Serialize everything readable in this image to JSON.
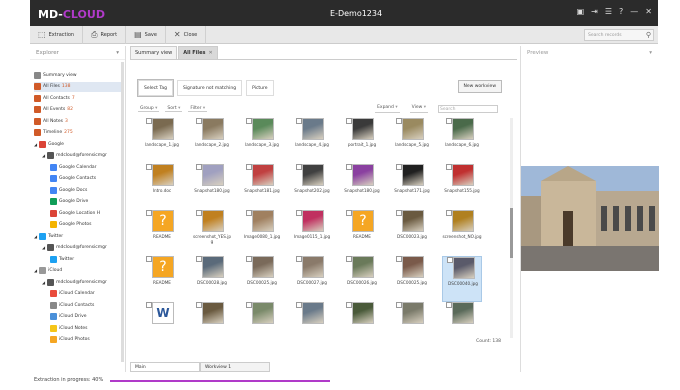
{
  "app": {
    "brand_main": "MD-",
    "brand_accent": "CLOUD",
    "case_name": "E-Demo1234",
    "accent_color": "#b03ac9"
  },
  "title_icons": [
    "screen-icon",
    "exit-icon",
    "settings-icon",
    "help-icon",
    "minimize-icon",
    "close-icon"
  ],
  "toolbar": {
    "buttons": [
      {
        "name": "extraction-button",
        "icon": "extraction-icon",
        "label": "Extraction"
      },
      {
        "name": "report-button",
        "icon": "printer-icon",
        "label": "Report"
      },
      {
        "name": "save-button",
        "icon": "save-icon",
        "label": "Save"
      },
      {
        "name": "close-case-button",
        "icon": "close-x-icon",
        "label": "Close"
      }
    ],
    "search_placeholder": "Search records"
  },
  "explorer": {
    "title": "Explorer",
    "items": [
      {
        "label": "Summary view",
        "count": "",
        "indent": 0,
        "color": "#888"
      },
      {
        "label": "All Files",
        "count": "138",
        "indent": 0,
        "color": "#d05a28",
        "selected": true
      },
      {
        "label": "All Contacts",
        "count": "7",
        "indent": 0,
        "color": "#d05a28"
      },
      {
        "label": "All Events",
        "count": "82",
        "indent": 0,
        "color": "#d05a28"
      },
      {
        "label": "All Notes",
        "count": "3",
        "indent": 0,
        "color": "#d05a28"
      },
      {
        "label": "Timeline",
        "count": "275",
        "indent": 0,
        "color": "#d05a28"
      },
      {
        "label": "Google",
        "count": "",
        "indent": 0,
        "color": "#db4437"
      },
      {
        "label": "mdcloud@forensicmgr",
        "count": "",
        "indent": 1,
        "color": "#555"
      },
      {
        "label": "Google Calendar",
        "count": "",
        "indent": 2,
        "color": "#4285f4"
      },
      {
        "label": "Google Contacts",
        "count": "",
        "indent": 2,
        "color": "#4285f4"
      },
      {
        "label": "Google Docs",
        "count": "",
        "indent": 2,
        "color": "#4285f4"
      },
      {
        "label": "Google Drive",
        "count": "",
        "indent": 2,
        "color": "#0f9d58"
      },
      {
        "label": "Google Location H",
        "count": "",
        "indent": 2,
        "color": "#db4437"
      },
      {
        "label": "Google Photos",
        "count": "",
        "indent": 2,
        "color": "#f4b400"
      },
      {
        "label": "Twitter",
        "count": "",
        "indent": 0,
        "color": "#1da1f2"
      },
      {
        "label": "mdcloud@forensicmgr",
        "count": "",
        "indent": 1,
        "color": "#555"
      },
      {
        "label": "Twitter",
        "count": "",
        "indent": 2,
        "color": "#1da1f2"
      },
      {
        "label": "iCloud",
        "count": "",
        "indent": 0,
        "color": "#999"
      },
      {
        "label": "mdcloud@forensicmgr",
        "count": "",
        "indent": 1,
        "color": "#555"
      },
      {
        "label": "iCloud Calendar",
        "count": "",
        "indent": 2,
        "color": "#e94b3c"
      },
      {
        "label": "iCloud Contacts",
        "count": "",
        "indent": 2,
        "color": "#888"
      },
      {
        "label": "iCloud Drive",
        "count": "",
        "indent": 2,
        "color": "#4a90d9"
      },
      {
        "label": "iCloud Notes",
        "count": "",
        "indent": 2,
        "color": "#f5c518"
      },
      {
        "label": "iCloud Photos",
        "count": "",
        "indent": 2,
        "color": "#f5a623"
      }
    ]
  },
  "tabs": [
    {
      "label": "Summary view",
      "active": false,
      "closable": false
    },
    {
      "label": "All Files",
      "active": true,
      "closable": true
    }
  ],
  "filters": {
    "buttons": [
      "Select Tag",
      "Signature not matching",
      "Picture"
    ],
    "new_workview": "New workview"
  },
  "controls": {
    "group": "Group",
    "sort": "Sort",
    "filter": "Filter",
    "expand": "Expand",
    "view": "View",
    "search": "Search"
  },
  "files": [
    {
      "label": "landscape_1.jpg",
      "kind": "photo",
      "color": "#7a6a50"
    },
    {
      "label": "landscape_2.jpg",
      "kind": "photo",
      "color": "#8a7a60"
    },
    {
      "label": "landscape_3.jpg",
      "kind": "photo",
      "color": "#5a8a5a"
    },
    {
      "label": "landscape_4.jpg",
      "kind": "photo",
      "color": "#6a7a8a"
    },
    {
      "label": "portrait_1.jpg",
      "kind": "photo",
      "color": "#3a3a3a"
    },
    {
      "label": "landscape_5.jpg",
      "kind": "photo",
      "color": "#9a8a60"
    },
    {
      "label": "landscape_6.jpg",
      "kind": "photo",
      "color": "#4a6a4a"
    },
    {
      "label": "Intro.doc",
      "kind": "photo",
      "color": "#c08020"
    },
    {
      "label": "Snapshot180.jpg",
      "kind": "photo",
      "color": "#a0a0c0"
    },
    {
      "label": "Snapshot181.jpg",
      "kind": "photo",
      "color": "#c04040"
    },
    {
      "label": "Snapshot202.jpg",
      "kind": "photo",
      "color": "#404040"
    },
    {
      "label": "Snapshot180.jpg",
      "kind": "photo",
      "color": "#8a40a0"
    },
    {
      "label": "Snapshot171.jpg",
      "kind": "photo",
      "color": "#202020"
    },
    {
      "label": "Snapshot155.jpg",
      "kind": "photo",
      "color": "#c03030"
    },
    {
      "label": "README",
      "kind": "unknown",
      "color": "#f5a623"
    },
    {
      "label": "screenshot_YES.jpg",
      "kind": "photo",
      "color": "#c08020"
    },
    {
      "label": "Image0080_1.jpg",
      "kind": "photo",
      "color": "#a08060"
    },
    {
      "label": "Image0115_1.jpg",
      "kind": "photo",
      "color": "#c03060"
    },
    {
      "label": "README",
      "kind": "unknown",
      "color": "#f5a623"
    },
    {
      "label": "DSC00023.jpg",
      "kind": "photo",
      "color": "#6a5a40"
    },
    {
      "label": "screenshot_NO.jpg",
      "kind": "photo",
      "color": "#b08020"
    },
    {
      "label": "README",
      "kind": "unknown",
      "color": "#f5a623"
    },
    {
      "label": "DSC00028.jpg",
      "kind": "photo",
      "color": "#5a6a7a"
    },
    {
      "label": "DSC00025.jpg",
      "kind": "photo",
      "color": "#7a6a5a"
    },
    {
      "label": "DSC00027.jpg",
      "kind": "photo",
      "color": "#8a7a6a"
    },
    {
      "label": "DSC00026.jpg",
      "kind": "photo",
      "color": "#6a7a5a"
    },
    {
      "label": "DSC00025.jpg",
      "kind": "photo",
      "color": "#7a5a4a"
    },
    {
      "label": "DSC00040.jpg",
      "kind": "photo",
      "color": "#5a5a6a",
      "selected": true
    },
    {
      "label": "",
      "kind": "word",
      "color": "#2b579a"
    },
    {
      "label": "",
      "kind": "photo",
      "color": "#6a5a40"
    },
    {
      "label": "",
      "kind": "photo",
      "color": "#7a8a6a"
    },
    {
      "label": "",
      "kind": "photo",
      "color": "#6a7a8a"
    },
    {
      "label": "",
      "kind": "photo",
      "color": "#4a5a3a"
    },
    {
      "label": "",
      "kind": "photo",
      "color": "#7a7a6a"
    },
    {
      "label": "",
      "kind": "photo",
      "color": "#5a6a5a"
    }
  ],
  "count_label": "Count: 138",
  "bottom_tabs": [
    "Main",
    "Workview 1"
  ],
  "preview": {
    "title": "Preview",
    "image": "church-photo"
  },
  "status": {
    "text": "Extraction in progress: 40%",
    "progress": 0.4
  }
}
